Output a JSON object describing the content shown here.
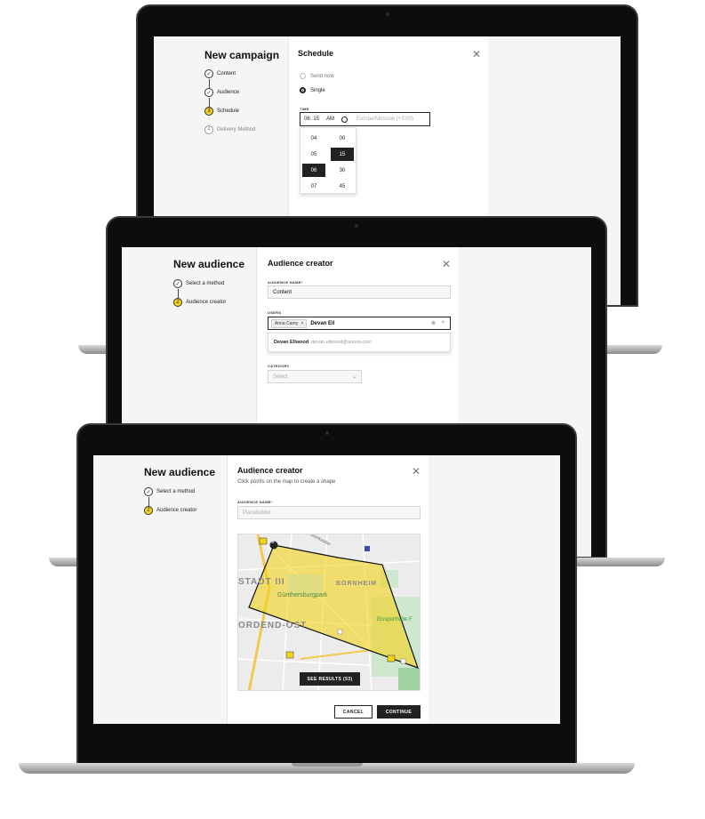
{
  "colors": {
    "accent": "#f4d31b",
    "dark": "#222222",
    "panel": "#f5f5f5"
  },
  "campaign": {
    "title": "New campaign",
    "steps": [
      {
        "label": "Content",
        "state": "done"
      },
      {
        "label": "Audience",
        "state": "done"
      },
      {
        "label": "Schedule",
        "state": "active",
        "num": "3"
      },
      {
        "label": "Delivery Method",
        "state": "pending",
        "num": "4"
      }
    ],
    "header": "Schedule",
    "options": {
      "send_now": "Send now",
      "single": "Single"
    },
    "time_label": "TIME",
    "time": {
      "hour": "06",
      "sep": ":",
      "minute": "15",
      "ampm": "AM",
      "tz": "Europe/Moscow (+3:00)"
    },
    "hours": [
      "04",
      "05",
      "06",
      "07"
    ],
    "minutes": [
      "00",
      "15",
      "30",
      "45"
    ]
  },
  "audience1": {
    "title": "New audience",
    "steps": [
      {
        "label": "Select a method",
        "state": "done"
      },
      {
        "label": "Audience creator",
        "state": "active",
        "num": "2"
      }
    ],
    "header": "Audience creator",
    "name_label": "AUDIENCE NAME*",
    "name_value": "Content",
    "users_label": "USERS",
    "chip": "Anna Carey",
    "chip_remove": "×",
    "typed": "Devan Ell",
    "suggestion_name": "Devan Ellwood",
    "suggestion_email": "devan.ellwood@anova.com",
    "category_label": "CATEGORY",
    "category_placeholder": "Select"
  },
  "audience2": {
    "title": "New audience",
    "steps": [
      {
        "label": "Select a method",
        "state": "done"
      },
      {
        "label": "Audience creator",
        "state": "active",
        "num": "2"
      }
    ],
    "header": "Audience creator",
    "subtitle": "Click points on the map to create a shape",
    "name_label": "AUDIENCE NAME*",
    "name_placeholder": "Placeholder",
    "map": {
      "labels": {
        "stadt": "STADT III",
        "bornheim": "BORNHEIM",
        "park": "Günthersburgpark",
        "nordend": "ORDEND-OST",
        "sporthalle": "Eissporthalle F",
        "street": "unorkastler"
      },
      "see_results": "SEE RESULTS (53)"
    },
    "cancel": "CANCEL",
    "continue": "CONTINUE"
  },
  "glyphs": {
    "check": "✓",
    "close": "✕",
    "clear": "⊗",
    "chevron_up": "^",
    "chevron_down": "⌄",
    "remove_point": "×"
  }
}
